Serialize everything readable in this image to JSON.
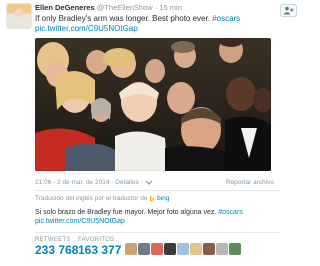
{
  "author": {
    "name": "Ellen DeGeneres",
    "handle": "@TheEllenShow",
    "time": "· 15 min"
  },
  "tweet": {
    "text": "If only Bradley's arm was longer. Best photo ever. ",
    "hashtag": "#oscars",
    "link": "pic.twitter.com/C9U5NOtGap"
  },
  "meta": {
    "timestamp": "21:06 - 2 de mar. de 2014",
    "details": "· Detalles ·",
    "report": "Reportar archivo"
  },
  "translation": {
    "label": "Traducido del inglés por el traductor de",
    "provider": "bing",
    "text": "Si solo brazo de Bradley fue mayor. Mejor foto alguna vez. ",
    "hashtag": "#oscars",
    "link": "pic.twitter.com/C9U5NOtGap"
  },
  "stats": {
    "retweets_label": "RETWEETS",
    "retweets_value": "233 768",
    "favorites_label": "FAVORITOS",
    "favorites_value": "163 377"
  },
  "colors": {
    "link": "#0084b4",
    "muted": "#8899a6",
    "text": "#292f33"
  },
  "icons": {
    "follow": "follow-person-icon",
    "more": "more-dots-icon",
    "dropdown": "chevron-down-icon"
  }
}
